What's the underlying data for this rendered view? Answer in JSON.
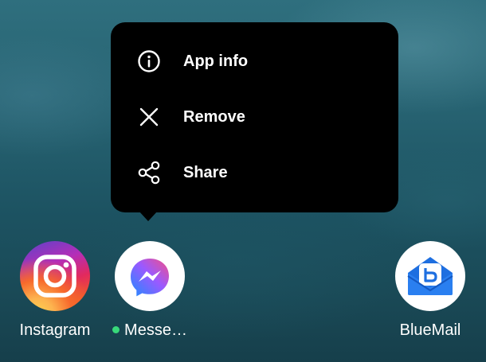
{
  "menu": {
    "items": [
      {
        "label": "App info",
        "icon": "info-icon"
      },
      {
        "label": "Remove",
        "icon": "close-icon"
      },
      {
        "label": "Share",
        "icon": "share-icon"
      }
    ]
  },
  "apps": [
    {
      "label": "Instagram",
      "icon": "instagram-icon"
    },
    {
      "label": "Messe…",
      "icon": "messenger-icon",
      "status_dot_color": "#38d97a"
    },
    {
      "label": "BlueMail",
      "icon": "bluemail-icon"
    }
  ],
  "colors": {
    "menu_background": "#000000",
    "menu_text": "#ffffff",
    "wallpaper": "#25606f",
    "bluemail_accent": "#1e6fe0",
    "messenger_gradient_start": "#1e8cff",
    "messenger_gradient_end": "#f24f86"
  }
}
